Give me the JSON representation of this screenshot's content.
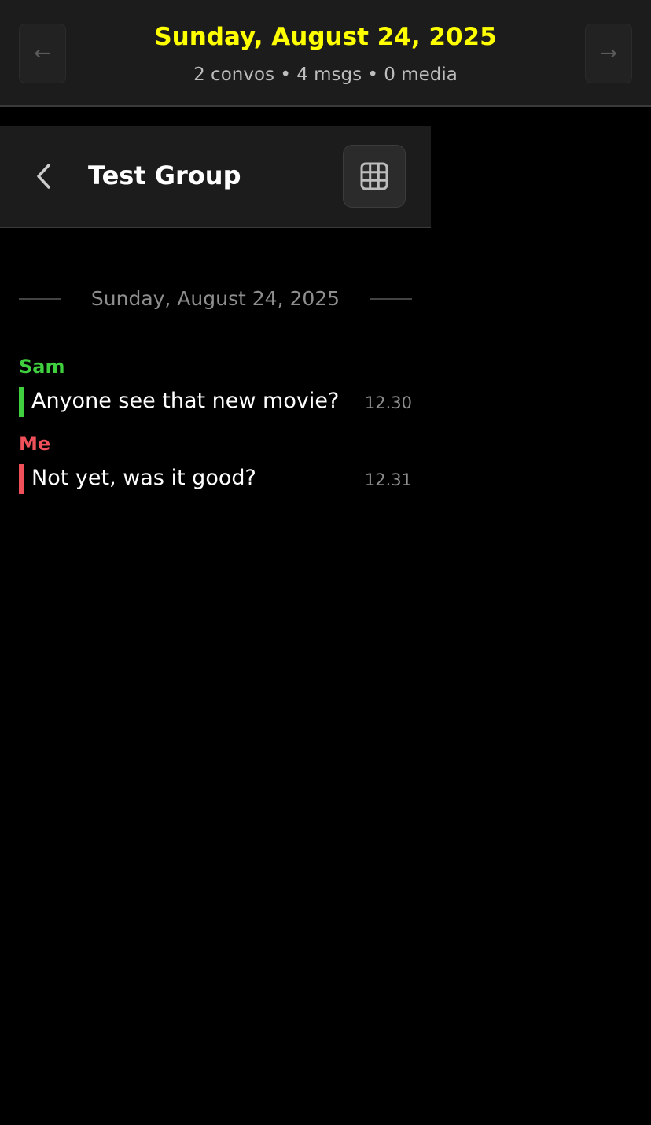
{
  "header": {
    "date": "Sunday, August 24, 2025",
    "stats": "2 convos • 4 msgs • 0 media",
    "prev_label": "←",
    "next_label": "→"
  },
  "chat": {
    "title": "Test Group",
    "date_divider": "Sunday, August 24, 2025",
    "back_icon": "chevron-left-icon",
    "grid_icon": "grid-icon",
    "messages": [
      {
        "sender": "Sam",
        "text": "Anyone see that new movie?",
        "time": "12.30",
        "color": "#3fcf3f"
      },
      {
        "sender": "Me",
        "text": "Not yet, was it good?",
        "time": "12.31",
        "color": "#f0505a"
      }
    ]
  },
  "colors": {
    "background": "#000000",
    "header_bg": "#1c1c1c",
    "accent_date": "#ffff00"
  }
}
